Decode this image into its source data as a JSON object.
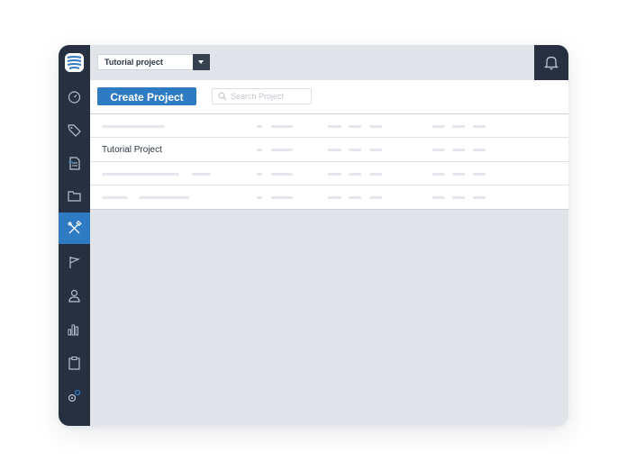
{
  "topbar": {
    "project_select": "Tutorial project"
  },
  "toolbar": {
    "create_label": "Create Project",
    "search_placeholder": "Search Project"
  },
  "table": {
    "rows": [
      {
        "name": "Tutorial Project"
      }
    ]
  },
  "sidebar": {
    "items": [
      {
        "icon": "dashboard-gauge-icon"
      },
      {
        "icon": "tag-icon"
      },
      {
        "icon": "document-icon"
      },
      {
        "icon": "folder-icon"
      },
      {
        "icon": "tools-icon",
        "active": true
      },
      {
        "icon": "flag-icon"
      },
      {
        "icon": "user-icon"
      },
      {
        "icon": "bar-chart-icon"
      },
      {
        "icon": "clipboard-icon"
      },
      {
        "icon": "settings-gears-icon"
      }
    ]
  },
  "colors": {
    "sidebar": "#263041",
    "accent": "#2e7bc4",
    "canvas": "#e1e5e9"
  }
}
